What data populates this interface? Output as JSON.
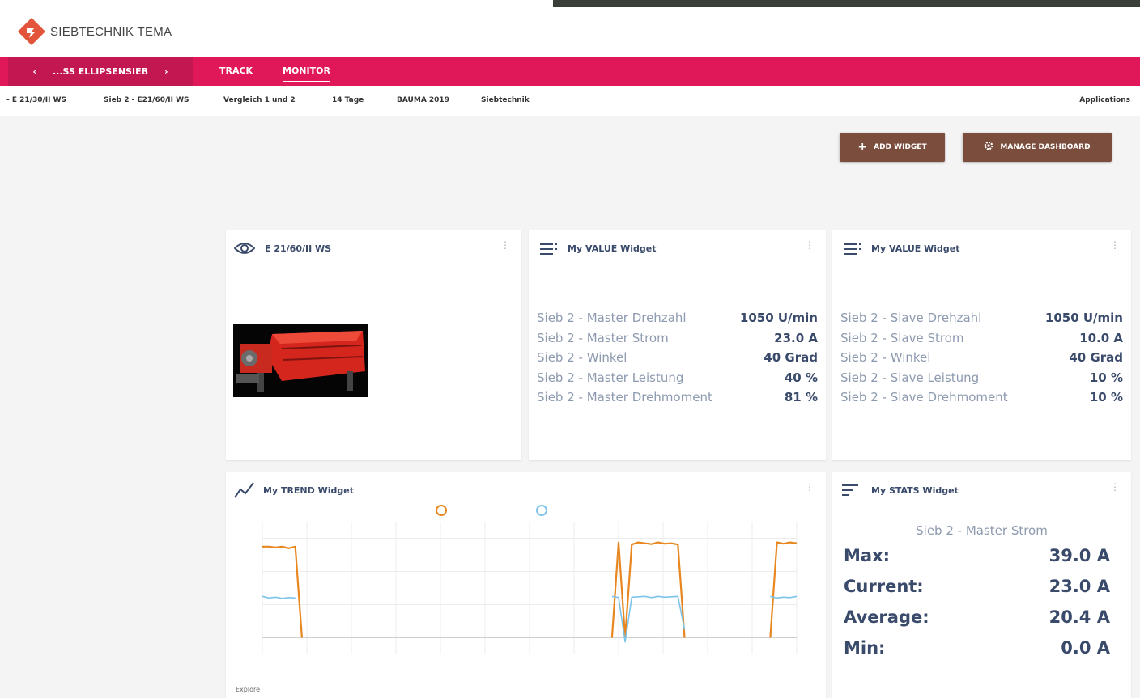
{
  "header": {
    "brand": "SIEBTECHNIK TEMA"
  },
  "nav": {
    "asset_prev": "‹",
    "asset_name": "...SS ELLIPSENSIEB",
    "asset_next": "›",
    "tabs": [
      {
        "label": "TRACK"
      },
      {
        "label": "MONITOR"
      }
    ]
  },
  "subnav": {
    "items": [
      {
        "label": "- E 21/30/II WS"
      },
      {
        "label": "Sieb 2 - E21/60/II WS"
      },
      {
        "label": "Vergleich 1 und 2"
      },
      {
        "label": "14 Tage"
      },
      {
        "label": "BAUMA 2019"
      },
      {
        "label": "Siebtechnik"
      }
    ],
    "applications": "Applications"
  },
  "toolbar": {
    "add_widget": "ADD WIDGET",
    "manage_dashboard": "MANAGE DASHBOARD",
    "add_icon": "+"
  },
  "widgets": {
    "asset": {
      "title": "E 21/60/II WS",
      "icon": "eye-icon"
    },
    "value_master": {
      "title": "My VALUE Widget",
      "rows": [
        {
          "label": "Sieb 2 - Master Drehzahl",
          "value": "1050 U/min"
        },
        {
          "label": "Sieb 2 - Master Strom",
          "value": "23.0 A"
        },
        {
          "label": "Sieb 2 - Winkel",
          "value": "40 Grad"
        },
        {
          "label": "Sieb 2 - Master Leistung",
          "value": "40 %"
        },
        {
          "label": "Sieb 2 - Master Drehmoment",
          "value": "81 %"
        }
      ]
    },
    "value_slave": {
      "title": "My VALUE Widget",
      "rows": [
        {
          "label": "Sieb 2 - Slave Drehzahl",
          "value": "1050 U/min"
        },
        {
          "label": "Sieb 2 - Slave Strom",
          "value": "10.0 A"
        },
        {
          "label": "Sieb 2 - Winkel",
          "value": "40 Grad"
        },
        {
          "label": "Sieb 2 - Slave Leistung",
          "value": "10 %"
        },
        {
          "label": "Sieb 2 - Slave Drehmoment",
          "value": "10 %"
        }
      ]
    },
    "trend": {
      "title": "My TREND Widget",
      "explore": "Explore"
    },
    "stats": {
      "title": "My STATS Widget",
      "metric": "Sieb 2 - Master Strom",
      "rows": [
        {
          "label": "Max:",
          "value": "39.0 A"
        },
        {
          "label": "Current:",
          "value": "23.0 A"
        },
        {
          "label": "Average:",
          "value": "20.4 A"
        },
        {
          "label": "Min:",
          "value": "0.0 A"
        }
      ]
    }
  },
  "colors": {
    "brand_red": "#e0185a",
    "button_brown": "#7a4d3d",
    "series_master": "#e8861f",
    "series_slave": "#7cc4ea"
  },
  "chart_data": {
    "type": "line",
    "series": [
      {
        "values": [
          22,
          22,
          21.8,
          22,
          21.6,
          22,
          0,
          null,
          null,
          null,
          null,
          null,
          null,
          null,
          null,
          null,
          null,
          null,
          null,
          null,
          null,
          null,
          null,
          null,
          null,
          null,
          null,
          null,
          null,
          null,
          null,
          null,
          null,
          null,
          null,
          null,
          null,
          null,
          null,
          null,
          null,
          null,
          null,
          null,
          null,
          null,
          null,
          null,
          null,
          null,
          null,
          null,
          null,
          0,
          23,
          0,
          22.5,
          23,
          22.8,
          22.6,
          23,
          22.7,
          22.8,
          22.5,
          0,
          null,
          null,
          null,
          null,
          null,
          null,
          null,
          null,
          null,
          null,
          null,
          null,
          0,
          23,
          22.7,
          23,
          22.8
        ]
      },
      {
        "values": [
          10,
          9.6,
          9.8,
          9.5,
          9.7,
          9.6,
          null,
          null,
          null,
          null,
          null,
          null,
          null,
          null,
          null,
          null,
          null,
          null,
          null,
          null,
          null,
          null,
          null,
          null,
          null,
          null,
          null,
          null,
          null,
          null,
          null,
          null,
          null,
          null,
          null,
          null,
          null,
          null,
          null,
          null,
          null,
          null,
          null,
          null,
          null,
          null,
          null,
          null,
          null,
          null,
          null,
          null,
          null,
          10,
          9.7,
          -1,
          9.8,
          9.9,
          10,
          9.7,
          10,
          9.8,
          9.9,
          10,
          2,
          null,
          null,
          null,
          null,
          null,
          null,
          null,
          null,
          null,
          null,
          null,
          null,
          10,
          9.6,
          9.8,
          9.7,
          10
        ]
      }
    ],
    "ylim": [
      -4,
      28
    ],
    "grid": true,
    "legend": "top-center"
  }
}
